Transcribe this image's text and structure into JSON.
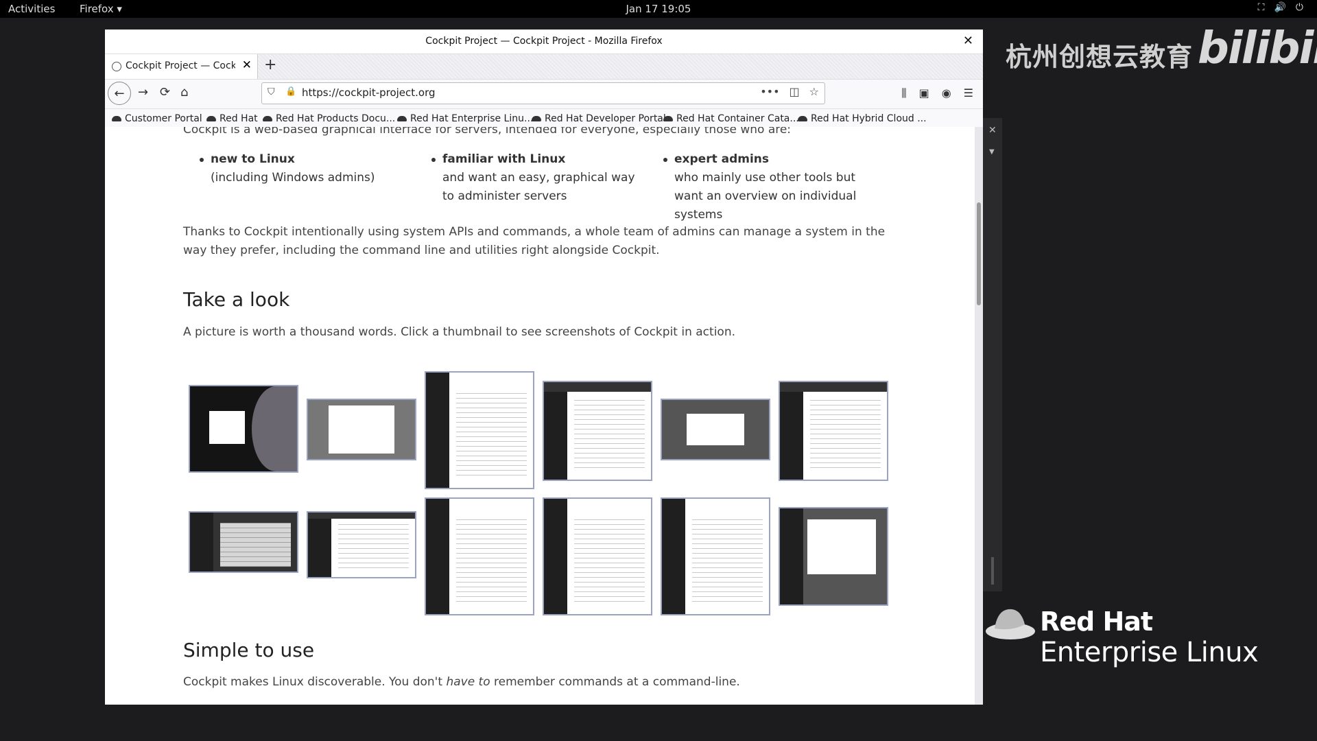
{
  "topbar": {
    "activities": "Activities",
    "app_menu": "Firefox ▾",
    "clock": "Jan 17  19:05",
    "sys_icons": [
      "network-icon",
      "volume-icon",
      "power-icon"
    ]
  },
  "watermark": {
    "chinese": "杭州创想云教育",
    "bilibili": "bilibili",
    "rh_line1": "Red Hat",
    "rh_line2": "Enterprise Linux"
  },
  "window": {
    "title": "Cockpit Project — Cockpit Project - Mozilla Firefox",
    "close": "✕"
  },
  "tab": {
    "label": "Cockpit Project — Cockpit Project",
    "close": "✕",
    "new": "+"
  },
  "nav": {
    "url": "https://cockpit-project.org",
    "more": "•••"
  },
  "bookmarks": [
    "Customer Portal",
    "Red Hat",
    "Red Hat Products Docu...",
    "Red Hat Enterprise Linu...",
    "Red Hat Developer Portal",
    "Red Hat Container Cata...",
    "Red Hat Hybrid Cloud ..."
  ],
  "page": {
    "cut_line": "Cockpit is a web-based graphical interface for servers, intended for everyone, especially those who are:",
    "audiences": [
      {
        "title": "new to Linux",
        "desc": "(including Windows admins)"
      },
      {
        "title": "familiar with Linux",
        "desc": "and want an easy, graphical way to administer servers"
      },
      {
        "title": "expert admins",
        "desc": "who mainly use other tools but want an overview on individual systems"
      }
    ],
    "thanks": "Thanks to Cockpit intentionally using system APIs and commands, a whole team of admins can manage a system in the way they prefer, including the command line and utilities right alongside Cockpit.",
    "take_look_heading": "Take a look",
    "take_look_text": "A picture is worth a thousand words. Click a thumbnail to see screenshots of Cockpit in action.",
    "simple_heading": "Simple to use",
    "simple_text_before": "Cockpit makes Linux discoverable. You don't ",
    "simple_text_em": "have to",
    "simple_text_after": " remember commands at a command-line."
  }
}
